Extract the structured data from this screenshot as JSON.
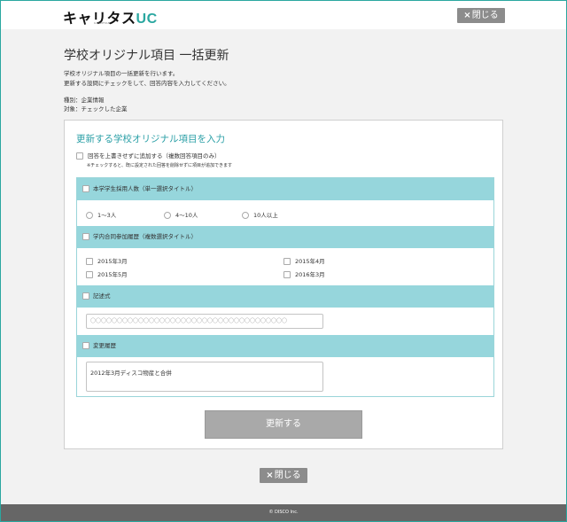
{
  "header": {
    "logo_main": "キャリタス",
    "logo_uc": "UC",
    "logo_sub": "CAREETAS",
    "close_label": "閉じる",
    "close_icon": "×"
  },
  "page": {
    "title": "学校オリジナル項目 一括更新",
    "desc1": "学校オリジナル項目の一括更新を行います。",
    "desc2": "更新する設問にチェックをして、回答内容を入力してください。",
    "meta1": "種別：企業情報",
    "meta2": "対象：チェックした企業"
  },
  "panel": {
    "title": "更新する学校オリジナル項目を入力",
    "overwrite_label": "回答を上書きせずに追加する（複数回答項目のみ）",
    "note": "※チェックすると、既に設定された回答を削除せずに項目が追加できます"
  },
  "items": [
    {
      "label": "本学学生採用人数（単一選択タイトル）",
      "options": [
        "1〜3人",
        "4〜10人",
        "10人以上"
      ]
    },
    {
      "label": "学内合同参加履歴（複数選択タイトル）",
      "options": [
        "2015年3月",
        "2015年4月",
        "2015年5月",
        "2016年3月"
      ]
    },
    {
      "label": "記述式",
      "placeholder": "〇〇〇〇〇〇〇〇〇〇〇〇〇〇〇〇〇〇〇〇〇〇〇〇〇〇〇〇〇〇〇〇〇〇〇〇〇"
    },
    {
      "label": "変更履歴",
      "value": "2012年3月ディスコ物産と合併"
    }
  ],
  "actions": {
    "update_label": "更新する"
  },
  "footer": {
    "copyright": "© DISCO Inc."
  },
  "colors": {
    "accent": "#2aa7a0",
    "item_header": "#96d6dc",
    "button_gray": "#a9a9a9",
    "footer": "#666666"
  }
}
